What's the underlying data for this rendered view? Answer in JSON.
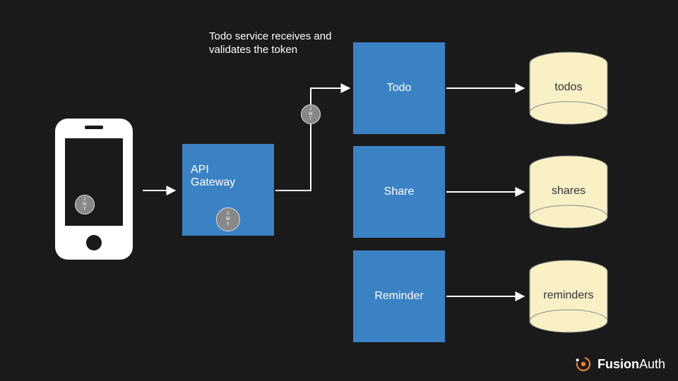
{
  "annotation": "Todo service receives and validates the token",
  "jwt_label": "J\nW\nT",
  "nodes": {
    "phone": {
      "type": "device"
    },
    "api_gateway": {
      "label": "API\nGateway"
    },
    "todo": {
      "label": "Todo"
    },
    "share": {
      "label": "Share"
    },
    "reminder": {
      "label": "Reminder"
    }
  },
  "databases": {
    "todos": {
      "label": "todos"
    },
    "shares": {
      "label": "shares"
    },
    "reminders": {
      "label": "reminders"
    }
  },
  "edges": [
    {
      "from": "phone",
      "to": "api_gateway"
    },
    {
      "from": "api_gateway",
      "to": "todo",
      "carries_jwt": true
    },
    {
      "from": "todo",
      "to": "todos"
    },
    {
      "from": "share",
      "to": "shares"
    },
    {
      "from": "reminder",
      "to": "reminders"
    }
  ],
  "brand": {
    "name_bold": "Fusion",
    "name_rest": "Auth",
    "accent": "#f58220"
  }
}
